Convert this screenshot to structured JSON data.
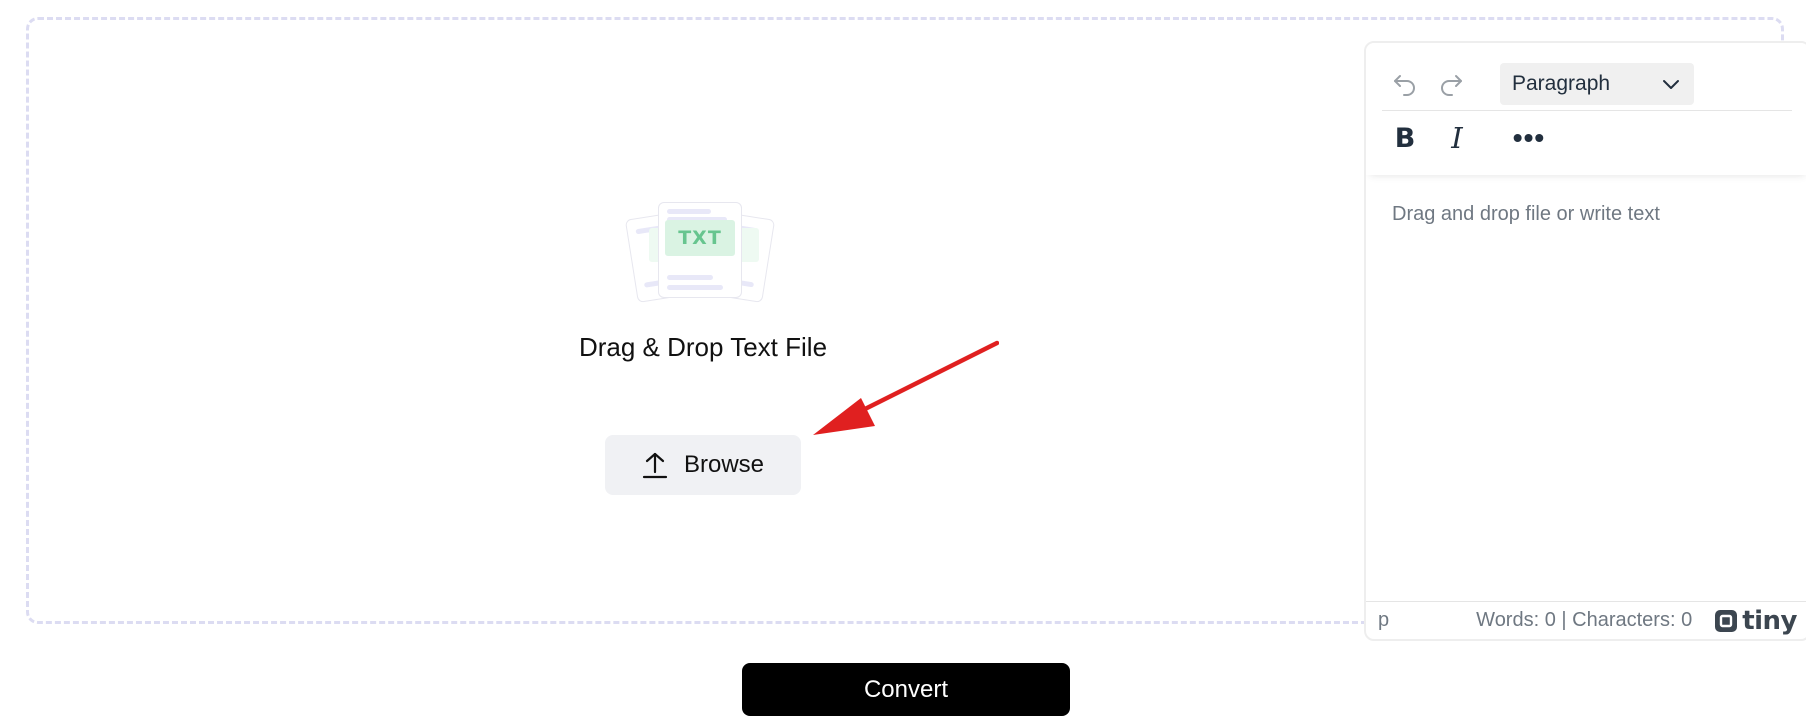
{
  "dropzone": {
    "badge_text": "TXT",
    "title": "Drag & Drop Text File",
    "browse_label": "Browse",
    "upload_icon": "upload-icon",
    "annotation_arrow_color": "#e02020"
  },
  "editor": {
    "toolbar": {
      "undo_icon": "undo-icon",
      "redo_icon": "redo-icon",
      "block_format": "Paragraph",
      "bold_label": "B",
      "italic_label": "I",
      "more_label": "•••"
    },
    "placeholder": "Drag and drop file or write text",
    "status": {
      "path": "p",
      "counts": "Words: 0 | Characters: 0",
      "brand": "tiny"
    }
  },
  "convert_label": "Convert",
  "colors": {
    "dropzone_border": "#dcdcf2",
    "browse_bg": "#f0f1f4",
    "convert_bg": "#000000",
    "badge_green": "#67c58f"
  }
}
